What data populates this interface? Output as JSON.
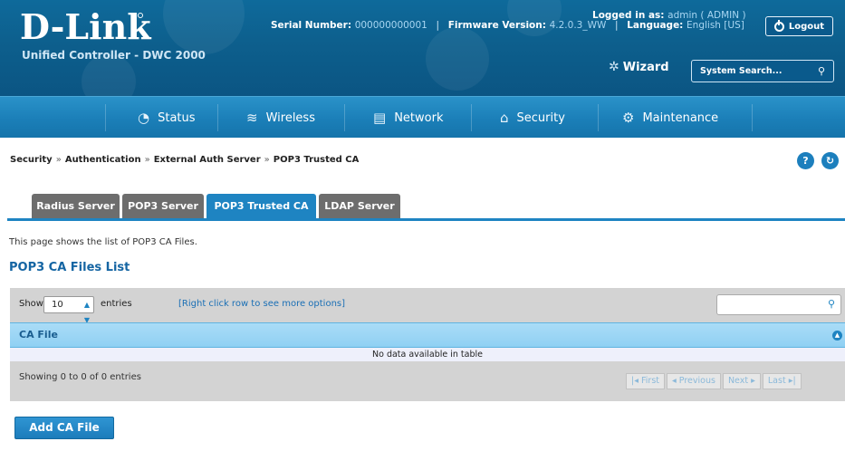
{
  "header": {
    "logo": "D-Link",
    "subtitle": "Unified Controller - DWC 2000",
    "serial_label": "Serial Number:",
    "serial_value": "000000000001",
    "firmware_label": "Firmware Version:",
    "firmware_value": "4.2.0.3_WW",
    "language_label": "Language:",
    "language_value": "English [US]",
    "logged_label": "Logged in as:",
    "logged_value": "admin ( ADMIN )",
    "logout_label": "Logout",
    "wizard_label": "Wizard",
    "search_placeholder": "System Search..."
  },
  "nav": [
    {
      "label": "Status",
      "icon": "status-icon"
    },
    {
      "label": "Wireless",
      "icon": "wifi-icon"
    },
    {
      "label": "Network",
      "icon": "network-icon"
    },
    {
      "label": "Security",
      "icon": "lock-icon"
    },
    {
      "label": "Maintenance",
      "icon": "gears-icon"
    }
  ],
  "breadcrumb": [
    "Security",
    "Authentication",
    "External Auth Server",
    "POP3 Trusted CA"
  ],
  "tabs": [
    {
      "label": "Radius Server",
      "active": false
    },
    {
      "label": "POP3 Server",
      "active": false
    },
    {
      "label": "POP3 Trusted CA",
      "active": true
    },
    {
      "label": "LDAP Server",
      "active": false
    }
  ],
  "page": {
    "description": "This page shows the list of POP3 CA Files.",
    "section_title": "POP3 CA Files List"
  },
  "table": {
    "show_label": "Show",
    "show_value": "10",
    "entries_label": "entries",
    "hint": "[Right click row to see more options]",
    "columns": [
      "CA File"
    ],
    "empty_message": "No data available in table",
    "showing": "Showing 0 to 0 of 0 entries",
    "pager": [
      "First",
      "Previous",
      "Next",
      "Last"
    ]
  },
  "actions": {
    "add_label": "Add CA File"
  },
  "colors": {
    "header": "#0d5f8d",
    "navbar": "#1b7fb8",
    "accent": "#1e84c2",
    "table_header": "#8fd0f3"
  }
}
